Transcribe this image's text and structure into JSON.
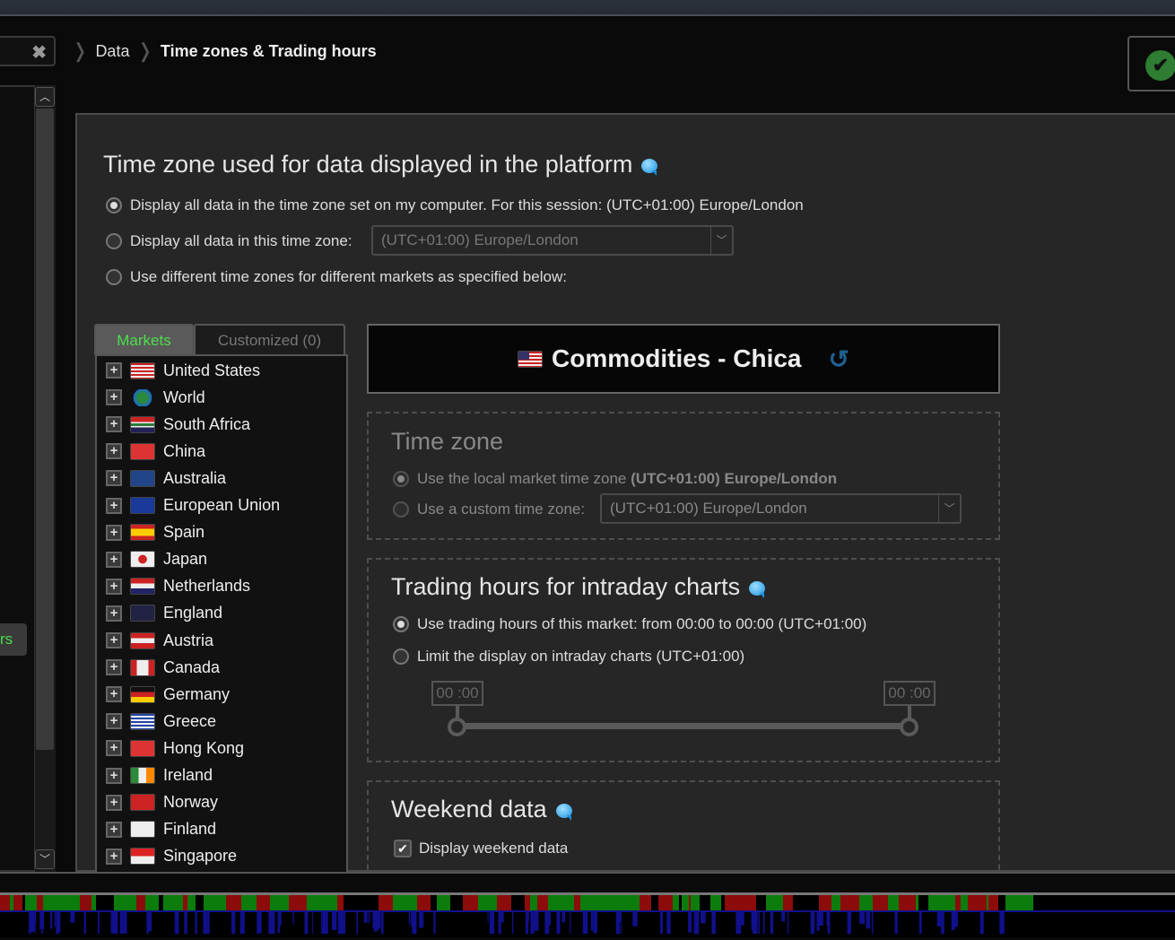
{
  "breadcrumb": {
    "items": [
      "Data",
      "Time zones & Trading hours"
    ]
  },
  "left": {
    "search_clear": "✖",
    "tab_fragment": "rs"
  },
  "main": {
    "title": "Time zone used for data displayed in the platform",
    "options": [
      {
        "label": "Display all data in the time zone set on my computer. For this session: (UTC+01:00) Europe/London",
        "selected": true
      },
      {
        "label": "Display all data in this time zone:",
        "selected": false,
        "select_value": "(UTC+01:00) Europe/London"
      },
      {
        "label": "Use different time zones for different markets as specified below:",
        "selected": false
      }
    ],
    "tabs": [
      {
        "label": "Markets",
        "active": true
      },
      {
        "label": "Customized (0)",
        "active": false
      }
    ],
    "markets": [
      "United States",
      "World",
      "South Africa",
      "China",
      "Australia",
      "European Union",
      "Spain",
      "Japan",
      "Netherlands",
      "England",
      "Austria",
      "Canada",
      "Germany",
      "Greece",
      "Hong Kong",
      "Ireland",
      "Norway",
      "Finland",
      "Singapore"
    ],
    "selected_market": {
      "title": "Commodities - Chica",
      "flag": "us-flag",
      "refresh_icon": "refresh-icon"
    },
    "timezone": {
      "title": "Time zone",
      "local_label": "Use the local market time zone ",
      "local_value": "(UTC+01:00) Europe/London",
      "custom_label": "Use a custom time zone:",
      "custom_value": "(UTC+01:00) Europe/London",
      "local_selected": true
    },
    "trading": {
      "title": "Trading hours for intraday charts",
      "opt1": "Use trading hours of this market: from 00:00 to 00:00 (UTC+01:00)",
      "opt2": "Limit the display on intraday charts  (UTC+01:00)",
      "opt1_selected": true,
      "start": "00 :00",
      "end": "00 :00"
    },
    "weekend": {
      "title": "Weekend data",
      "checkbox": "Display weekend data",
      "checked": true
    }
  },
  "colors": {
    "accent_green": "#4cdf4c",
    "up": "#0c7c0c",
    "down": "#8c0c0c",
    "volume": "#10108c"
  }
}
